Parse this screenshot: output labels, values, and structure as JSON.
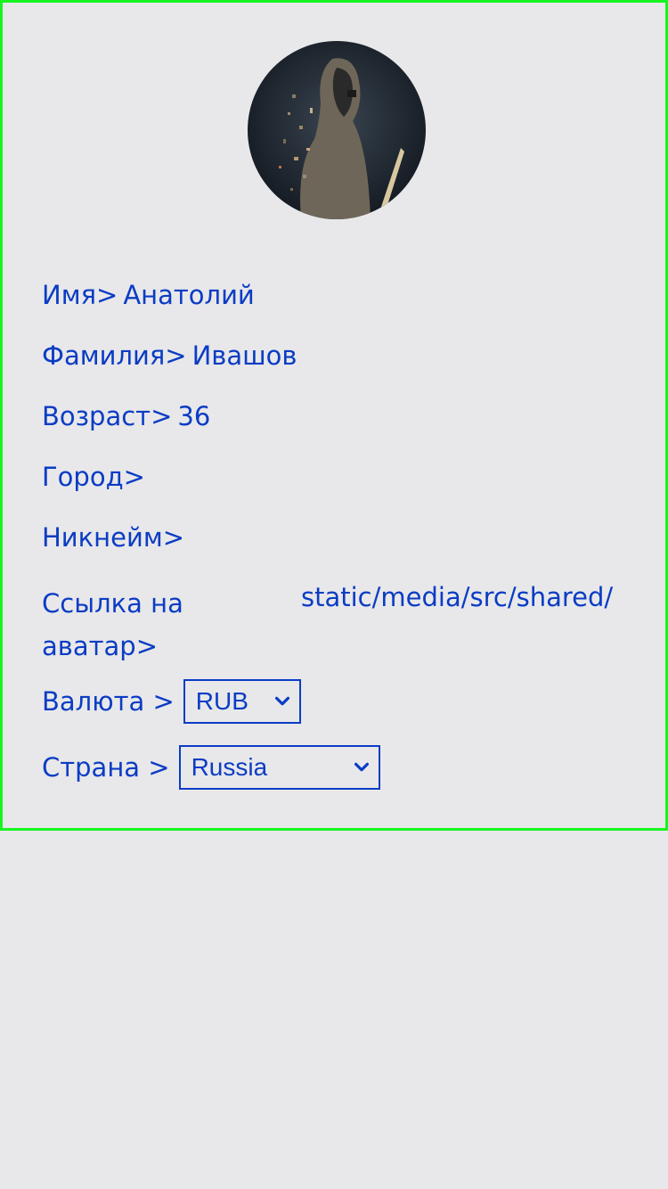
{
  "profile": {
    "avatar_alt": "avatar",
    "fields": {
      "first_name": {
        "label": "Имя>",
        "value": "Анатолий"
      },
      "last_name": {
        "label": "Фамилия>",
        "value": "Ивашов"
      },
      "age": {
        "label": "Возраст>",
        "value": "36"
      },
      "city": {
        "label": "Город>",
        "value": ""
      },
      "nickname": {
        "label": "Никнейм>",
        "value": ""
      },
      "avatar_link": {
        "label": "Ссылка на аватар>",
        "value": "static/media/src/shared/"
      }
    },
    "currency": {
      "label": "Валюта >",
      "selected": "RUB"
    },
    "country": {
      "label": "Страна >",
      "selected": "Russia"
    }
  },
  "colors": {
    "text": "#0b3cc4",
    "border": "#16f51f",
    "background": "#e8e8ea"
  },
  "icons": {
    "select_chevron": "chevron-down-icon"
  }
}
